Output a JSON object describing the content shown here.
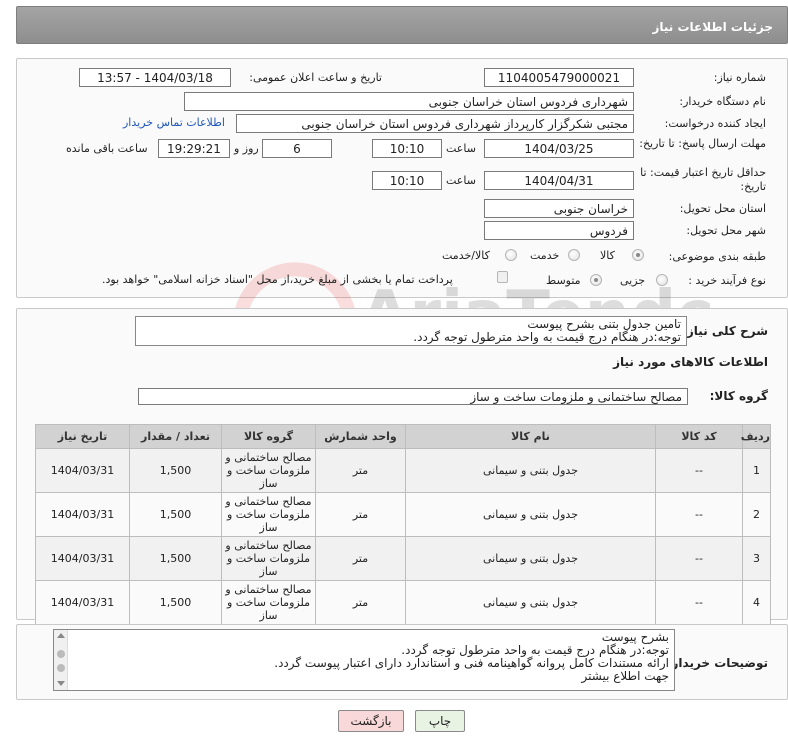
{
  "page_title": "جزئیات اطلاعات نیاز",
  "fields": {
    "need_number_label": "شماره نیاز:",
    "need_number": "1104005479000021",
    "announce_label": "تاریخ و ساعت اعلان عمومی:",
    "announce_value": "1404/03/18 - 13:57",
    "buyer_org_label": "نام دستگاه خریدار:",
    "buyer_org": "شهرداری فردوس استان خراسان جنوبی",
    "creator_label": "ایجاد کننده درخواست:",
    "creator": "مجتبی شکرگزار کارپرداز شهرداری فردوس استان خراسان جنوبی",
    "contact_link": "اطلاعات تماس خریدار",
    "reply_deadline_label": "مهلت ارسال پاسخ: تا تاریخ:",
    "reply_date": "1404/03/25",
    "time_label": "ساعت",
    "reply_time": "10:10",
    "days_value": "6",
    "days_label": "روز و",
    "remaining_time": "19:29:21",
    "remaining_label": "ساعت باقی مانده",
    "price_validity_label": "حداقل تاریخ اعتبار قیمت: تا تاریخ:",
    "price_date": "1404/04/31",
    "price_time": "10:10",
    "province_label": "استان محل تحویل:",
    "province": "خراسان جنوبی",
    "city_label": "شهر محل تحویل:",
    "city": "فردوس",
    "category_label": "طبقه بندی موضوعی:",
    "category_options": [
      "کالا",
      "خدمت",
      "کالا/خدمت"
    ],
    "purchase_type_label": "نوع فرآیند خرید :",
    "purchase_options": [
      "جزیی",
      "متوسط"
    ],
    "payment_note": "پرداخت تمام یا بخشی از مبلغ خرید،از محل \"اسناد خزانه اسلامی\" خواهد بود."
  },
  "summary": {
    "label": "شرح کلی نیاز:",
    "line1": "تامین جدول بتنی بشرح پیوست",
    "line2": "توجه:در هنگام درج قیمت به واحد مترطول توجه گردد."
  },
  "goods": {
    "section_title": "اطلاعات کالاهای مورد نیاز",
    "group_label": "گروه کالا:",
    "group_value": "مصالح ساختمانی و ملزومات ساخت و ساز",
    "headers": [
      "ردیف",
      "کد کالا",
      "نام کالا",
      "واحد شمارش",
      "گروه کالا",
      "تعداد / مقدار",
      "تاریخ نیاز"
    ],
    "rows": [
      {
        "idx": "1",
        "code": "--",
        "name": "جدول بتنی و سیمانی",
        "unit": "متر",
        "group": "مصالح ساختمانی و ملزومات ساخت و ساز",
        "qty": "1,500",
        "date": "1404/03/31"
      },
      {
        "idx": "2",
        "code": "--",
        "name": "جدول بتنی و سیمانی",
        "unit": "متر",
        "group": "مصالح ساختمانی و ملزومات ساخت و ساز",
        "qty": "1,500",
        "date": "1404/03/31"
      },
      {
        "idx": "3",
        "code": "--",
        "name": "جدول بتنی و سیمانی",
        "unit": "متر",
        "group": "مصالح ساختمانی و ملزومات ساخت و ساز",
        "qty": "1,500",
        "date": "1404/03/31"
      },
      {
        "idx": "4",
        "code": "--",
        "name": "جدول بتنی و سیمانی",
        "unit": "متر",
        "group": "مصالح ساختمانی و ملزومات ساخت و ساز",
        "qty": "1,500",
        "date": "1404/03/31"
      }
    ]
  },
  "buyer_notes": {
    "label": "توضیحات خریدار:",
    "lines": [
      "بشرح پیوست",
      "توجه:در هنگام درج قیمت به واحد مترطول توجه گردد.",
      "ارائه مستندات کامل پروانه گواهینامه فنی و استاندارد دارای اعتبار پیوست گردد.",
      "جهت اطلاع بیشتر"
    ]
  },
  "buttons": {
    "print": "چاپ",
    "back": "بازگشت"
  },
  "watermark": "AriaTender.net",
  "colors": {
    "header": "#999999",
    "link": "#1f56b8",
    "back_btn": "#f8d8d8",
    "print_btn": "#e9f3e4"
  }
}
